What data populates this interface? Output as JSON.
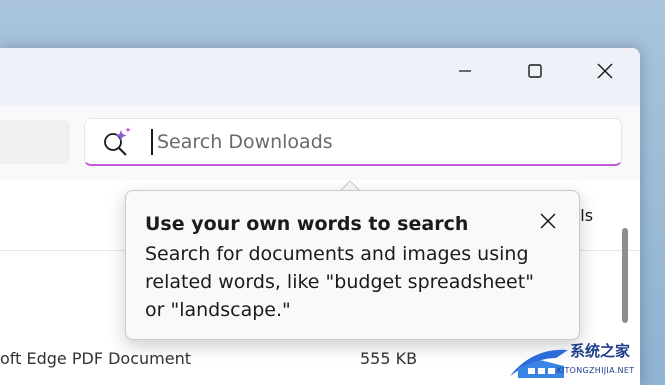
{
  "window_controls": {
    "minimize_icon": "minimize-icon",
    "maximize_icon": "maximize-icon",
    "close_icon": "close-icon"
  },
  "search": {
    "placeholder": "Search Downloads",
    "icon": "ai-search-icon",
    "accent_color": "#c05bd1"
  },
  "command_bar": {
    "details_label": "ails"
  },
  "file_row": {
    "name": "oft Edge PDF Document",
    "size": "555 KB"
  },
  "tooltip": {
    "title": "Use your own words to search",
    "body": "Search for documents and images using related words, like \"budget spreadsheet\" or \"landscape.\"",
    "close_icon": "close-icon"
  },
  "watermark": {
    "text": "系统之家",
    "url": "XITONGZHIJIA.NET"
  }
}
